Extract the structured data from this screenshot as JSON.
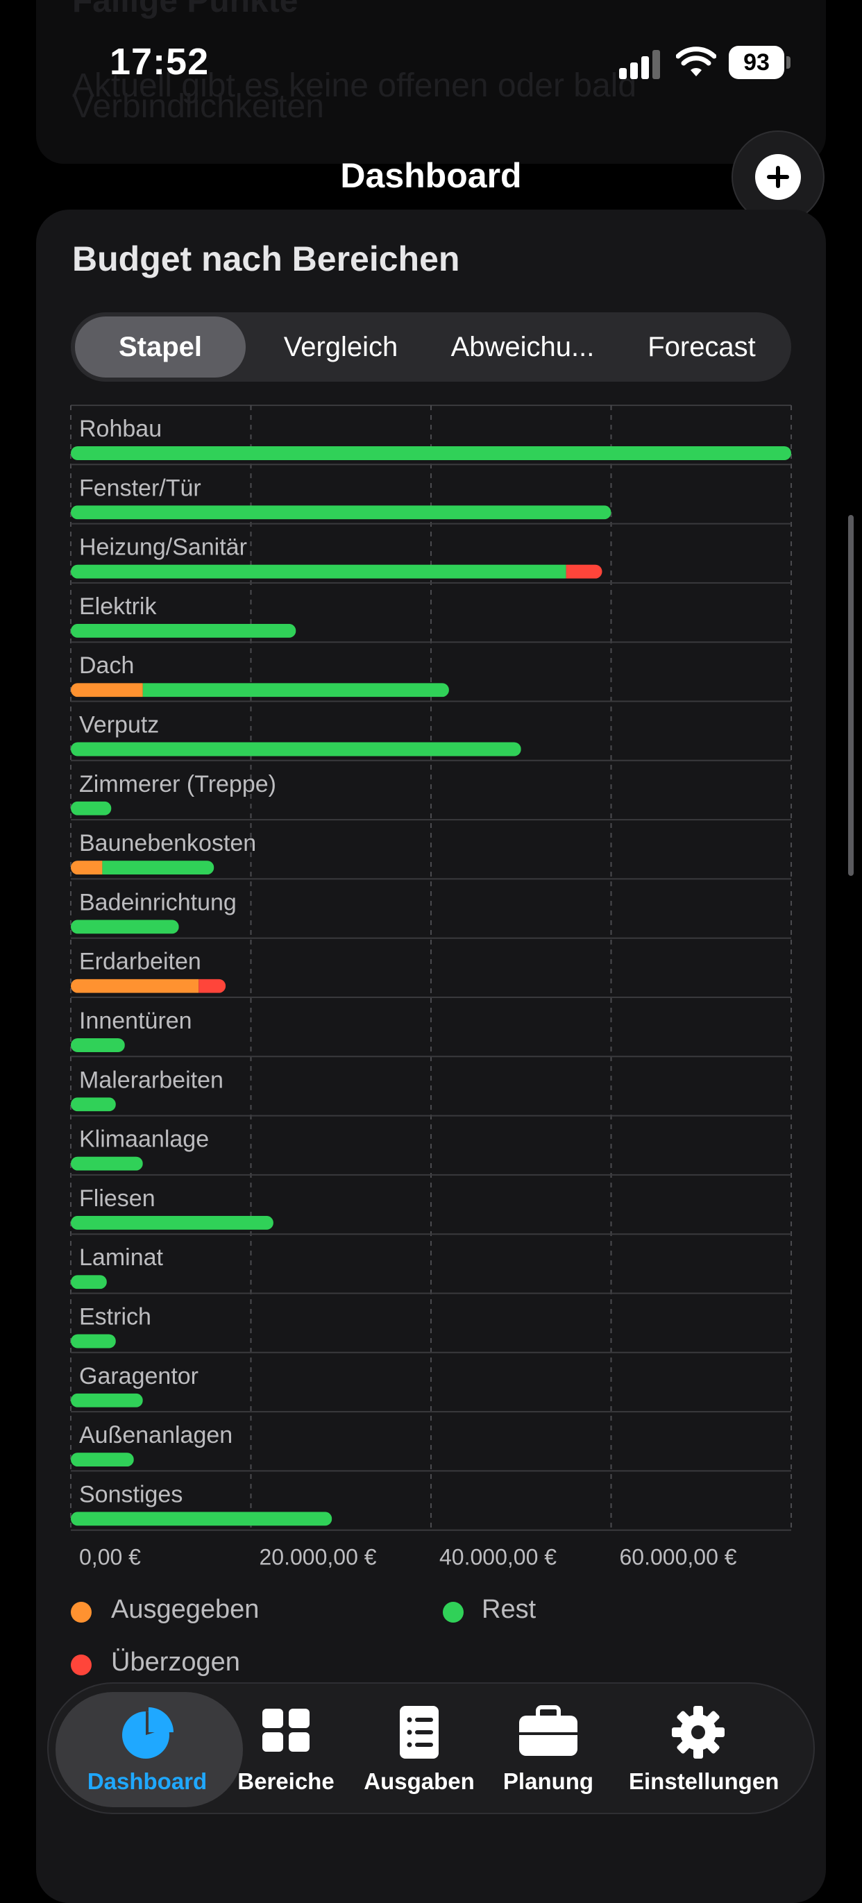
{
  "status_bar": {
    "time": "17:52",
    "battery": "93"
  },
  "background": {
    "line1": "Fällige Punkte",
    "line2": "Aktuell gibt es keine offenen oder bald",
    "line3": "Verbindlichkeiten"
  },
  "nav": {
    "title": "Dashboard",
    "add_icon": "plus-circle-icon"
  },
  "card": {
    "title": "Budget nach Bereichen"
  },
  "segments": {
    "items": [
      "Stapel",
      "Vergleich",
      "Abweichu...",
      "Forecast"
    ],
    "selected": "Stapel"
  },
  "colors": {
    "spent": "#ff9230",
    "rest": "#30d158",
    "over": "#ff453a",
    "accent": "#1fa8ff"
  },
  "chart_data": {
    "type": "bar",
    "orientation": "horizontal",
    "stacked": true,
    "title": "Budget nach Bereichen",
    "x_ticks": [
      "0,00 €",
      "20.000,00 €",
      "40.000,00 €",
      "60.000,00 €"
    ],
    "xlim": [
      0,
      80000
    ],
    "grid": true,
    "legend_position": "bottom",
    "categories": [
      "Rohbau",
      "Fenster/Tür",
      "Heizung/Sanitär",
      "Elektrik",
      "Dach",
      "Verputz",
      "Zimmerer (Treppe)",
      "Baunebenkosten",
      "Badeinrichtung",
      "Erdarbeiten",
      "Innentüren",
      "Malerarbeiten",
      "Klimaanlage",
      "Fliesen",
      "Laminat",
      "Estrich",
      "Garagentor",
      "Außenanlagen",
      "Sonstiges"
    ],
    "series": [
      {
        "name": "Ausgegeben",
        "values": [
          0,
          0,
          0,
          0,
          8000,
          0,
          0,
          3500,
          0,
          14200,
          0,
          0,
          0,
          0,
          0,
          0,
          0,
          0,
          0
        ]
      },
      {
        "name": "Rest",
        "values": [
          80000,
          60000,
          55000,
          25000,
          34000,
          50000,
          4500,
          12400,
          12000,
          0,
          6000,
          5000,
          8000,
          22500,
          4000,
          5000,
          8000,
          7000,
          29000
        ]
      },
      {
        "name": "Überzogen",
        "values": [
          0,
          0,
          4000,
          0,
          0,
          0,
          0,
          0,
          0,
          3000,
          0,
          0,
          0,
          0,
          0,
          0,
          0,
          0,
          0
        ]
      }
    ]
  },
  "legend": {
    "spent": "Ausgegeben",
    "rest": "Rest",
    "over": "Überzogen"
  },
  "tabbar": {
    "items": [
      {
        "label": "Dashboard",
        "icon": "pie-chart-icon"
      },
      {
        "label": "Bereiche",
        "icon": "grid-icon"
      },
      {
        "label": "Ausgaben",
        "icon": "list-icon"
      },
      {
        "label": "Planung",
        "icon": "briefcase-icon"
      },
      {
        "label": "Einstellungen",
        "icon": "gear-icon"
      }
    ],
    "selected": "Dashboard"
  }
}
